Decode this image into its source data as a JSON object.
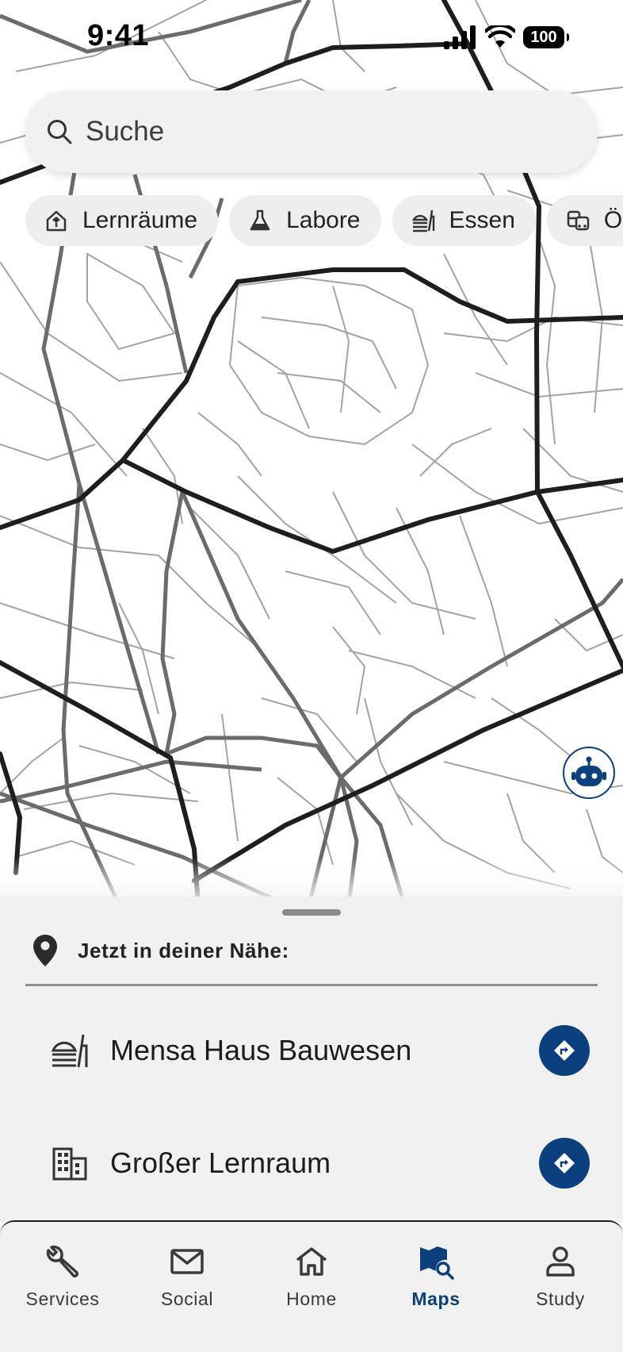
{
  "status_bar": {
    "time": "9:41",
    "battery": "100"
  },
  "search": {
    "placeholder": "Suche"
  },
  "chips": [
    {
      "label": "Lernräume",
      "icon": "study-room-icon"
    },
    {
      "label": "Labore",
      "icon": "lab-flask-icon"
    },
    {
      "label": "Essen",
      "icon": "food-icon"
    },
    {
      "label": "ÖPNV",
      "icon": "transit-icon"
    }
  ],
  "nearby": {
    "title": "Jetzt in deiner Nähe:",
    "items": [
      {
        "name": "Mensa Haus Bauwesen",
        "icon": "food-icon"
      },
      {
        "name": "Großer Lernraum",
        "icon": "building-icon"
      }
    ]
  },
  "tabs": [
    {
      "label": "Services",
      "icon": "wrench-icon",
      "active": false
    },
    {
      "label": "Social",
      "icon": "mail-icon",
      "active": false
    },
    {
      "label": "Home",
      "icon": "home-icon",
      "active": false
    },
    {
      "label": "Maps",
      "icon": "map-search-icon",
      "active": true
    },
    {
      "label": "Study",
      "icon": "person-icon",
      "active": false
    }
  ],
  "colors": {
    "accent": "#0b3f7e",
    "sheet_bg": "#f1f1f1",
    "chip_bg": "#eeeeee",
    "major_road": "#1e1e1e",
    "secondary_road": "#666666",
    "minor_road": "#a0a0a0"
  }
}
